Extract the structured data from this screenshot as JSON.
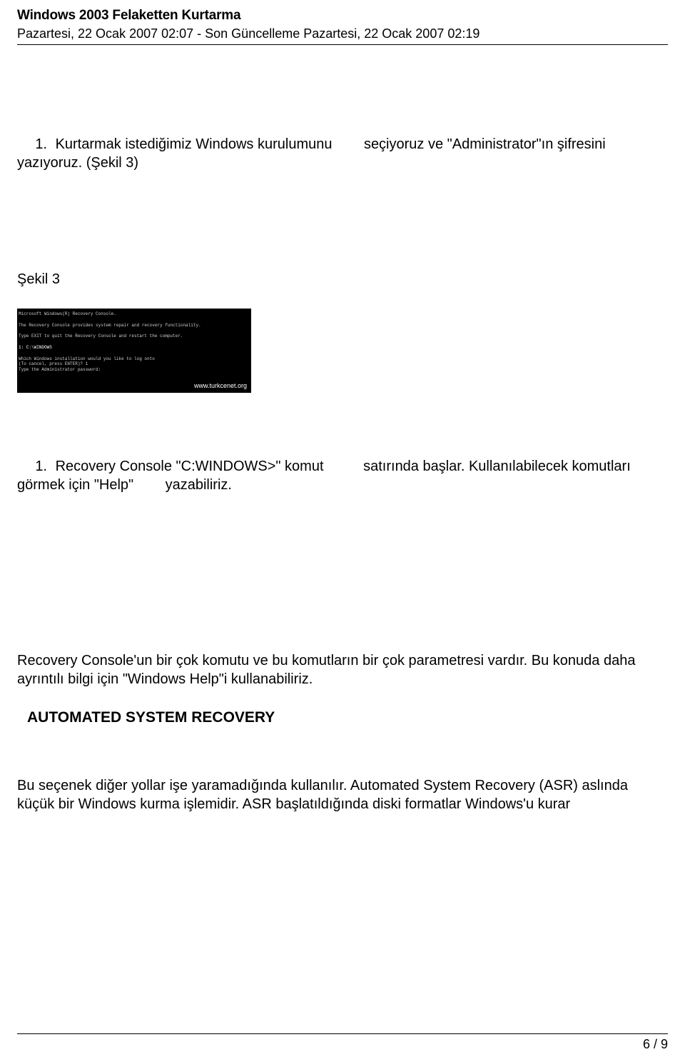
{
  "header": {
    "title": "Windows 2003 Felaketten Kurtarma",
    "meta": "Pazartesi, 22 Ocak 2007 02:07 - Son Güncelleme Pazartesi, 22 Ocak 2007 02:19"
  },
  "body": {
    "p1_num": "1.",
    "p1_a": "Kurtarmak istediğimiz Windows kurulumunu",
    "p1_b": "seçiyoruz ve \"Administrator\"ın şifresini",
    "p1_c": "yazıyoruz. (Şekil 3)",
    "fig_label": "Şekil 3",
    "console": {
      "line1": "Microsoft Windows(R) Recovery Console.",
      "line2": "The Recovery Console provides system repair and recovery functionality.",
      "line3": "Type EXIT to quit the Recovery Console and restart the computer.",
      "line4": "1: C:\\WINDOWS",
      "line5": "Which Windows installation would you like to log onto",
      "line6": "(To cancel, press ENTER)? 1",
      "line7": "Type the Administrator password:",
      "url": "www.turkcenet.org"
    },
    "p2_num": "1.",
    "p2_a": "Recovery Console \"C:WINDOWS>\" komut",
    "p2_b": "satırında başlar. Kullanılabilecek komutları",
    "p2_c": "görmek için \"Help\"",
    "p2_d": "yazabiliriz.",
    "p3": "Recovery Console'un bir çok komutu ve bu komutların bir çok parametresi vardır. Bu konuda daha ayrıntılı bilgi için \"Windows Help\"i kullanabiliriz.",
    "heading": "AUTOMATED SYSTEM RECOVERY",
    "p4": "Bu seçenek diğer yollar işe yaramadığında kullanılır. Automated System Recovery (ASR) aslında küçük bir Windows kurma işlemidir. ASR başlatıldığında diski formatlar Windows'u kurar"
  },
  "footer": {
    "page": "6 / 9"
  }
}
